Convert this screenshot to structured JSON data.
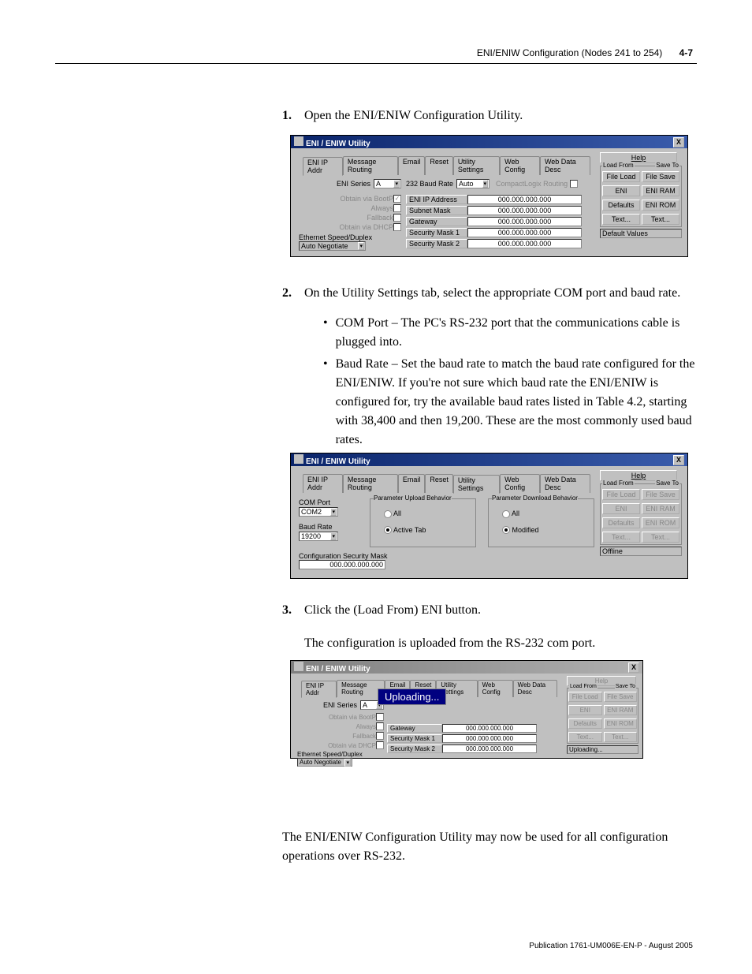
{
  "header": {
    "title": "ENI/ENIW Configuration (Nodes 241 to 254)",
    "page_num": "4-7"
  },
  "steps": {
    "s1": {
      "num": "1.",
      "text": "Open the ENI/ENIW Configuration Utility."
    },
    "s2": {
      "num": "2.",
      "text": "On the Utility Settings tab, select the appropriate COM port and baud rate.",
      "bullets": {
        "b1": "COM Port – The PC's RS-232 port that the communications cable is plugged into.",
        "b2": "Baud Rate – Set the baud rate to match the baud rate configured for the ENI/ENIW. If you're not sure which baud rate the ENI/ENIW is configured for, try the available baud rates listed in Table 4.2, starting with 38,400 and then 19,200. These are the most commonly used baud rates."
      }
    },
    "s3": {
      "num": "3.",
      "text": "Click the (Load From) ENI button.",
      "after": "The configuration is uploaded from the RS-232 com port."
    }
  },
  "closing": "The ENI/ENIW Configuration Utility may now be used for all configuration operations over RS-232.",
  "footer": "Publication 1761-UM006E-EN-P - August 2005",
  "sc": {
    "title": "ENI / ENIW Utility",
    "close_x": "X",
    "tabs": {
      "eni_ip": "ENI IP Addr",
      "msg_routing": "Message Routing",
      "email": "Email",
      "reset": "Reset",
      "util": "Utility Settings",
      "web_config": "Web Config",
      "web_data": "Web Data Desc"
    },
    "help_btn": "Help",
    "load_from": "Load From",
    "save_to": "Save To",
    "btns": {
      "file_load": "File Load",
      "file_save": "File Save",
      "eni": "ENI",
      "eni_ram": "ENI RAM",
      "defaults": "Defaults",
      "eni_rom": "ENI ROM",
      "text_l": "Text...",
      "text_r": "Text..."
    },
    "status_default": "Default Values",
    "status_offline": "Offline",
    "status_uploading": "Uploading...",
    "sc1": {
      "eni_series": "ENI Series",
      "eni_series_val": "A",
      "baud_232": "232 Baud Rate",
      "baud_232_val": "Auto",
      "clogix": "CompactLogix Routing",
      "obtain_bootp": "Obtain via BootP",
      "always": "Always",
      "fallback": "Fallback",
      "obtain_dhcp": "Obtain via DHCP",
      "eth_speed": "Ethernet Speed/Duplex",
      "auto_neg": "Auto Negotiate",
      "ip_addr": "ENI IP Address",
      "subnet": "Subnet Mask",
      "gateway": "Gateway",
      "sec1": "Security Mask 1",
      "sec2": "Security Mask 2",
      "ip_zero": "000.000.000.000"
    },
    "sc2": {
      "com_port": "COM Port",
      "com_port_val": "COM2",
      "baud_rate": "Baud Rate",
      "baud_rate_val": "19200",
      "cfg_sec_mask": "Configuration Security Mask",
      "cfg_val": "000.000.000.000",
      "upload_label": "Parameter Upload Behavior",
      "download_label": "Parameter Download Behavior",
      "all": "All",
      "active_tab": "Active Tab",
      "modified": "Modified"
    },
    "uploading_overlay": "Uploading..."
  }
}
